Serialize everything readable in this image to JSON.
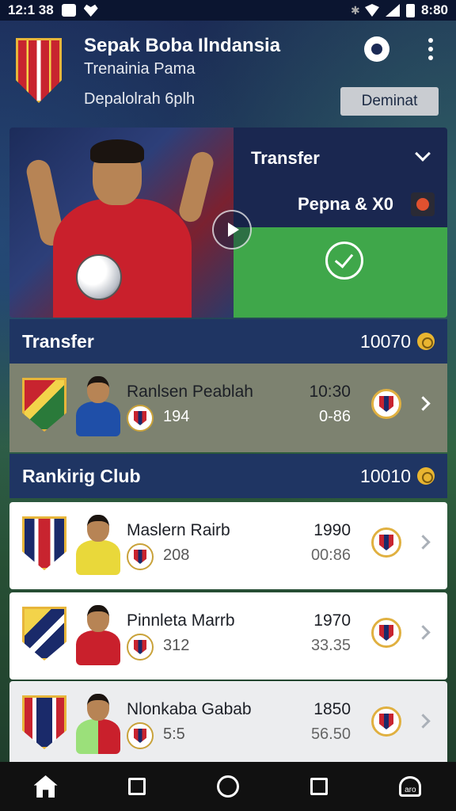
{
  "status_bar": {
    "time": "12:1 38",
    "battery_time": "8:80"
  },
  "header": {
    "title": "Sepak Boba Ilndansia",
    "subtitle": "Trenainia Pama",
    "tagline": "Depalolrah 6plh",
    "action_button": "Deminat"
  },
  "hero": {
    "panel_title": "Transfer",
    "panel_value": "Pepna & X0"
  },
  "transfer_section": {
    "title": "Transfer",
    "value": "10070",
    "row": {
      "name": "Ranlsen Peablah",
      "sub": "194",
      "score": "10:30",
      "score2": "0-86"
    }
  },
  "ranking_section": {
    "title": "Rankirig Club",
    "value": "10010",
    "rows": [
      {
        "name": "Maslern Rairb",
        "sub": "208",
        "score": "1990",
        "score2": "00:86"
      },
      {
        "name": "Pinnleta Marrb",
        "sub": "312",
        "score": "1970",
        "score2": "33.35"
      },
      {
        "name": "Nlonkaba Gabab",
        "sub": "5:5",
        "score": "1850",
        "score2": "56.50"
      }
    ]
  },
  "bottom_nav": {
    "profile_label": "aro"
  },
  "colors": {
    "accent_green": "#3fa74a",
    "navy": "#1a2750",
    "gold": "#e9b530"
  }
}
